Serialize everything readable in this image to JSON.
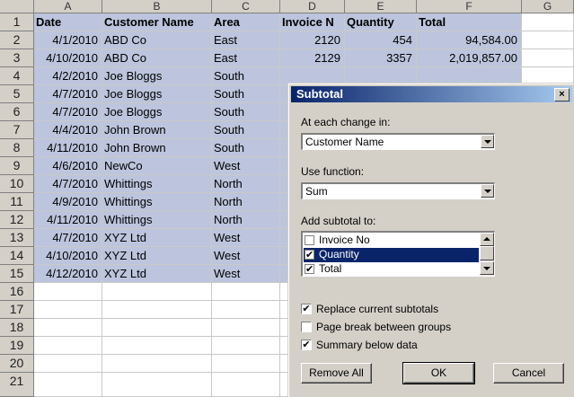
{
  "sheet": {
    "columns": [
      "A",
      "B",
      "C",
      "D",
      "E",
      "F",
      "G"
    ],
    "rows": [
      "1",
      "2",
      "3",
      "4",
      "5",
      "6",
      "7",
      "8",
      "9",
      "10",
      "11",
      "12",
      "13",
      "14",
      "15",
      "16",
      "17",
      "18",
      "19",
      "20",
      "21"
    ],
    "headers": {
      "date": "Date",
      "customer": "Customer Name",
      "area": "Area",
      "invoice": "Invoice N",
      "quantity": "Quantity",
      "total": "Total"
    },
    "records": [
      {
        "date": "4/1/2010",
        "customer": "ABD Co",
        "area": "East",
        "invoice": "2120",
        "quantity": "454",
        "total": "94,584.00"
      },
      {
        "date": "4/10/2010",
        "customer": "ABD Co",
        "area": "East",
        "invoice": "2129",
        "quantity": "3357",
        "total": "2,019,857.00"
      },
      {
        "date": "4/2/2010",
        "customer": "Joe Bloggs",
        "area": "South",
        "invoice": "",
        "quantity": "",
        "total": ""
      },
      {
        "date": "4/7/2010",
        "customer": "Joe Bloggs",
        "area": "South",
        "invoice": "",
        "quantity": "",
        "total": ""
      },
      {
        "date": "4/7/2010",
        "customer": "Joe Bloggs",
        "area": "South",
        "invoice": "",
        "quantity": "",
        "total": ""
      },
      {
        "date": "4/4/2010",
        "customer": "John Brown",
        "area": "South",
        "invoice": "",
        "quantity": "",
        "total": ""
      },
      {
        "date": "4/11/2010",
        "customer": "John Brown",
        "area": "South",
        "invoice": "",
        "quantity": "",
        "total": ""
      },
      {
        "date": "4/6/2010",
        "customer": "NewCo",
        "area": "West",
        "invoice": "",
        "quantity": "",
        "total": ""
      },
      {
        "date": "4/7/2010",
        "customer": "Whittings",
        "area": "North",
        "invoice": "",
        "quantity": "",
        "total": ""
      },
      {
        "date": "4/9/2010",
        "customer": "Whittings",
        "area": "North",
        "invoice": "",
        "quantity": "",
        "total": ""
      },
      {
        "date": "4/11/2010",
        "customer": "Whittings",
        "area": "North",
        "invoice": "",
        "quantity": "",
        "total": ""
      },
      {
        "date": "4/7/2010",
        "customer": "XYZ Ltd",
        "area": "West",
        "invoice": "",
        "quantity": "",
        "total": ""
      },
      {
        "date": "4/10/2010",
        "customer": "XYZ Ltd",
        "area": "West",
        "invoice": "",
        "quantity": "",
        "total": ""
      },
      {
        "date": "4/12/2010",
        "customer": "XYZ Ltd",
        "area": "West",
        "invoice": "",
        "quantity": "",
        "total": ""
      }
    ]
  },
  "dialog": {
    "title": "Subtotal",
    "close_label": "×",
    "change_label": "At each change in:",
    "change_value": "Customer Name",
    "function_label": "Use function:",
    "function_value": "Sum",
    "addto_label": "Add subtotal to:",
    "addto_items": [
      {
        "label": "Invoice No",
        "checked": false,
        "highlighted": false
      },
      {
        "label": "Quantity",
        "checked": true,
        "highlighted": true
      },
      {
        "label": "Total",
        "checked": true,
        "highlighted": false
      }
    ],
    "options": [
      {
        "label": "Replace current subtotals",
        "checked": true
      },
      {
        "label": "Page break between groups",
        "checked": false
      },
      {
        "label": "Summary below data",
        "checked": true
      }
    ],
    "remove_all_label": "Remove All",
    "ok_label": "OK",
    "cancel_label": "Cancel"
  },
  "colors": {
    "selection": "#bcc5dd",
    "header_gray": "#d4d0c8",
    "dialog_title": "#0a246a",
    "list_highlight": "#0a246a"
  }
}
